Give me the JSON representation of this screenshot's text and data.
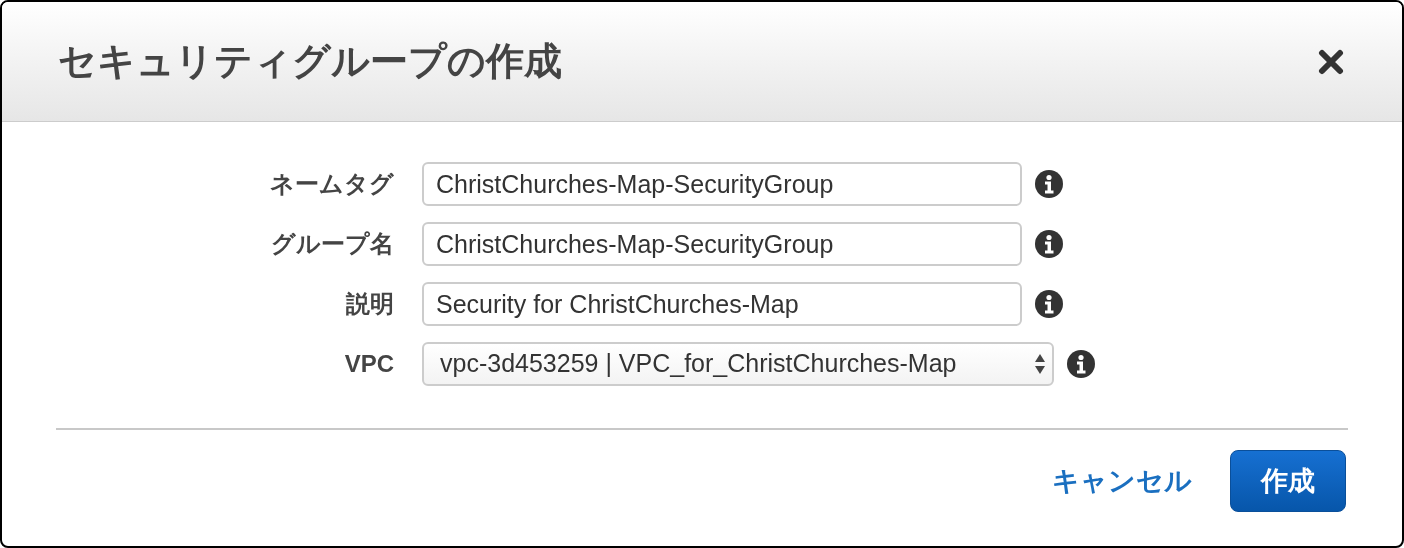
{
  "dialog": {
    "title": "セキュリティグループの作成"
  },
  "fields": [
    {
      "label": "ネームタグ",
      "kind": "text",
      "value": "ChristChurches-Map-SecurityGroup"
    },
    {
      "label": "グループ名",
      "kind": "text",
      "value": "ChristChurches-Map-SecurityGroup"
    },
    {
      "label": "説明",
      "kind": "text",
      "value": "Security for ChristChurches-Map"
    },
    {
      "label": "VPC",
      "kind": "select",
      "value": "vpc-3d453259 | VPC_for_ChristChurches-Map"
    }
  ],
  "buttons": {
    "cancel": "キャンセル",
    "create": "作成"
  }
}
